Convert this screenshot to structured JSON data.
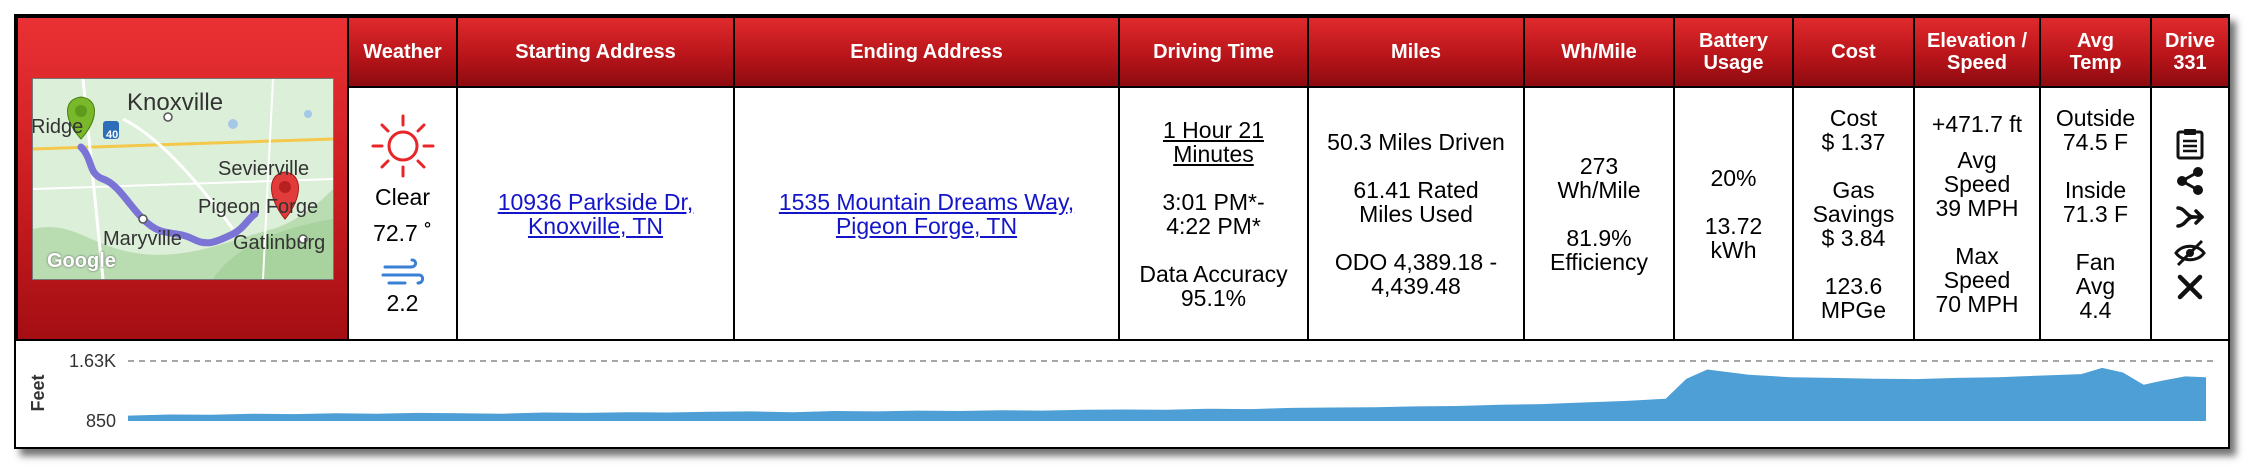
{
  "headers": {
    "weather": "Weather",
    "start": "Starting Address",
    "end": "Ending Address",
    "time": "Driving Time",
    "miles": "Miles",
    "whmile": "Wh/Mile",
    "battery": "Battery Usage",
    "cost": "Cost",
    "elev": "Elevation / Speed",
    "temp": "Avg Temp",
    "drive": "Drive 331"
  },
  "map": {
    "labels": [
      "Knoxville",
      "Sevierville",
      "Pigeon Forge",
      "Maryville",
      "Gatlinburg",
      "Ridge",
      "40"
    ],
    "watermark": "Google"
  },
  "weather": {
    "condition": "Clear",
    "temp": "72.7 ˚",
    "wind": "2.2",
    "sun_color": "#e8262a",
    "wind_color": "#3a7fd6"
  },
  "start": {
    "line1": "10936 Parkside Dr,",
    "line2": "Knoxville, TN"
  },
  "end": {
    "line1": "1535 Mountain Dreams Way,",
    "line2": "Pigeon Forge, TN"
  },
  "time": {
    "duration1": "1 Hour 21",
    "duration2": "Minutes",
    "range1": "3:01 PM*-",
    "range2": "4:22 PM*",
    "accuracy_label": "Data Accuracy",
    "accuracy_value": "95.1%"
  },
  "miles": {
    "driven": "50.3 Miles Driven",
    "rated1": "61.41 Rated",
    "rated2": "Miles Used",
    "odo1": "ODO 4,389.18 -",
    "odo2": "4,439.48"
  },
  "whmile": {
    "value": "273",
    "unit": "Wh/Mile",
    "eff_value": "81.9%",
    "eff_label": "Efficiency"
  },
  "battery": {
    "percent": "20%",
    "kwh_value": "13.72",
    "kwh_unit": "kWh"
  },
  "cost": {
    "label": "Cost",
    "value": "$ 1.37",
    "gas1": "Gas",
    "gas2": "Savings",
    "gas_value": "$ 3.84",
    "mpge_value": "123.6",
    "mpge_unit": "MPGe"
  },
  "elev": {
    "gain": "+471.7 ft",
    "avg1": "Avg",
    "avg2": "Speed",
    "avg3": "39 MPH",
    "max1": "Max",
    "max2": "Speed",
    "max3": "70 MPH"
  },
  "temp": {
    "out_label": "Outside",
    "out_value": "74.5 F",
    "in_label": "Inside",
    "in_value": "71.3 F",
    "fan1": "Fan",
    "fan2": "Avg",
    "fan3": "4.4"
  },
  "actions": [
    "clipboard-icon",
    "share-icon",
    "merge-icon",
    "hide-icon",
    "close-icon"
  ],
  "colors": {
    "header_red": "#c0171c",
    "link_blue": "#1414c8",
    "elevation_fill": "#4d9fd6",
    "route": "#7b73d6"
  },
  "chart_data": {
    "type": "area",
    "ylabel": "Feet",
    "yticks": [
      "1.63K",
      "850"
    ],
    "ylim": [
      850,
      1630
    ],
    "x": [
      0,
      2,
      4,
      6,
      8,
      10,
      12,
      14,
      16,
      18,
      20,
      22,
      24,
      26,
      28,
      30,
      32,
      34,
      36,
      38,
      40,
      42,
      44,
      46,
      48,
      50,
      52,
      54,
      56,
      58,
      60,
      62,
      64,
      66,
      68,
      70,
      72,
      74,
      75,
      76,
      78,
      80,
      82,
      84,
      86,
      88,
      90,
      92,
      94,
      95,
      96,
      97,
      98,
      99,
      100
    ],
    "y": [
      920,
      935,
      930,
      945,
      940,
      950,
      945,
      955,
      950,
      945,
      960,
      955,
      965,
      960,
      970,
      975,
      965,
      980,
      975,
      985,
      980,
      990,
      985,
      995,
      1000,
      995,
      1010,
      1005,
      1020,
      1025,
      1030,
      1040,
      1045,
      1060,
      1070,
      1090,
      1110,
      1140,
      1400,
      1520,
      1450,
      1420,
      1410,
      1400,
      1395,
      1410,
      1420,
      1440,
      1460,
      1540,
      1480,
      1320,
      1380,
      1430,
      1420
    ]
  }
}
